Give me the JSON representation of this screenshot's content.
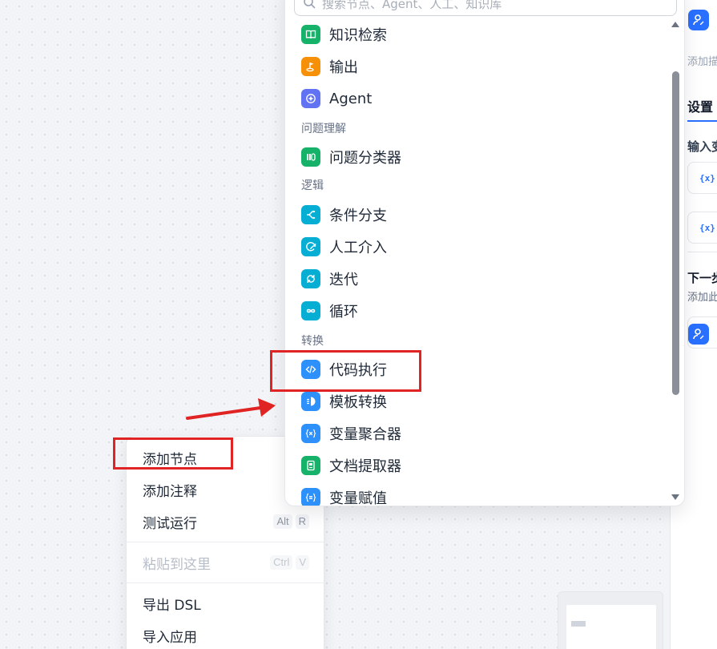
{
  "search": {
    "placeholder": "搜索节点、Agent、人工、知识库"
  },
  "nodes_top": [
    {
      "label": "知识检索",
      "icon": "book-icon",
      "color": "#17b26a"
    },
    {
      "label": "输出",
      "icon": "flag-icon",
      "color": "#f79009"
    },
    {
      "label": "Agent",
      "icon": "agent-icon",
      "color": "#6172f3"
    }
  ],
  "groups": {
    "question": {
      "label": "问题理解",
      "items": [
        {
          "label": "问题分类器",
          "icon": "classifier-icon",
          "color": "#17b26a"
        }
      ]
    },
    "logic": {
      "label": "逻辑",
      "items": [
        {
          "label": "条件分支",
          "icon": "branch-icon",
          "color": "#06aed4"
        },
        {
          "label": "人工介入",
          "icon": "human-icon",
          "color": "#06aed4"
        },
        {
          "label": "迭代",
          "icon": "iterate-icon",
          "color": "#06aed4"
        },
        {
          "label": "循环",
          "icon": "loop-icon",
          "color": "#06aed4"
        }
      ]
    },
    "transform": {
      "label": "转换",
      "items": [
        {
          "label": "代码执行",
          "icon": "code-icon",
          "color": "#2e90fa"
        },
        {
          "label": "模板转换",
          "icon": "template-icon",
          "color": "#2e90fa"
        },
        {
          "label": "变量聚合器",
          "icon": "variable-icon",
          "color": "#2e90fa"
        },
        {
          "label": "文档提取器",
          "icon": "doc-extract-icon",
          "color": "#17b26a"
        },
        {
          "label": "变量赋值",
          "icon": "assign-icon",
          "color": "#2e90fa"
        }
      ]
    }
  },
  "context_menu": {
    "add_node": "添加节点",
    "add_note": "添加注释",
    "test_run": "测试运行",
    "test_run_keys": [
      "Alt",
      "R"
    ],
    "paste_here": "粘贴到这里",
    "paste_keys": [
      "Ctrl",
      "V"
    ],
    "export_dsl": "导出 DSL",
    "import_app": "导入应用"
  },
  "right_panel": {
    "add_hint": "添加描述...",
    "settings_tab": "设置",
    "input_vars": "输入变量",
    "var1": "{x} query",
    "var2": "{x} files",
    "next_step": "下一步",
    "next_step_hint": "添加此工作流中的下一个节点"
  },
  "colors": {
    "accent": "#2970ff",
    "annotation": "#e02424"
  }
}
